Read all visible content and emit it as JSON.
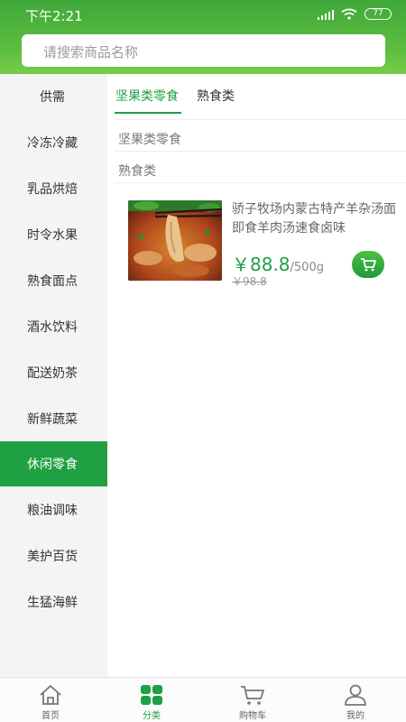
{
  "status_bar": {
    "time": "下午2:21",
    "battery": "77"
  },
  "search": {
    "placeholder": "请搜索商品名称"
  },
  "sidebar": {
    "items": [
      {
        "label": "供需"
      },
      {
        "label": "冷冻冷藏"
      },
      {
        "label": "乳品烘焙"
      },
      {
        "label": "时令水果"
      },
      {
        "label": "熟食面点"
      },
      {
        "label": "酒水饮料"
      },
      {
        "label": "配送奶茶"
      },
      {
        "label": "新鲜蔬菜"
      },
      {
        "label": "休闲零食",
        "active": true
      },
      {
        "label": "粮油调味"
      },
      {
        "label": "美护百货"
      },
      {
        "label": "生猛海鲜"
      }
    ]
  },
  "subtabs": [
    {
      "label": "坚果类零食",
      "active": true
    },
    {
      "label": "熟食类"
    }
  ],
  "sections": [
    {
      "title": "坚果类零食"
    },
    {
      "title": "熟食类"
    }
  ],
  "product": {
    "name": "骄子牧场内蒙古特产羊杂汤面即食羊肉汤速食卤味",
    "price": "￥88.8",
    "unit": "/500g",
    "old_price": "￥98.8"
  },
  "tabbar": {
    "items": [
      {
        "label": "首页",
        "icon": "home-icon"
      },
      {
        "label": "分类",
        "icon": "category-icon",
        "active": true
      },
      {
        "label": "购物车",
        "icon": "cart-icon"
      },
      {
        "label": "我的",
        "icon": "user-icon"
      }
    ]
  },
  "colors": {
    "brand_green": "#1fa043",
    "header_green": "#3fa83a"
  }
}
